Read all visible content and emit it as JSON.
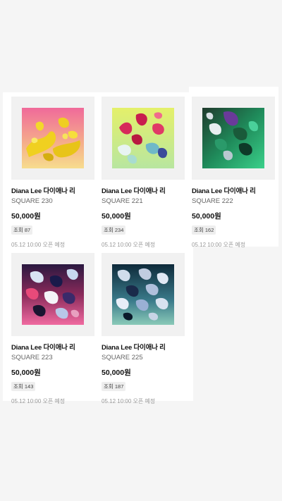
{
  "products": [
    {
      "artist": "Diana Lee 다이애나 리",
      "title": "SQUARE 230",
      "price": "50,000원",
      "views": "조회 87",
      "open": "05.12 10:00 오픈 예정",
      "art": "yellow-abstract-art"
    },
    {
      "artist": "Diana Lee 다이애나 리",
      "title": "SQUARE 221",
      "price": "50,000원",
      "views": "조회 234",
      "open": "05.12 10:00 오픈 예정",
      "art": "lime-petals-art"
    },
    {
      "artist": "Diana Lee 다이애나 리",
      "title": "SQUARE 222",
      "price": "50,000원",
      "views": "조회 162",
      "open": "05.12 10:00 오픈 예정",
      "art": "green-crystal-art"
    },
    {
      "artist": "Diana Lee 다이애나 리",
      "title": "SQUARE 223",
      "price": "50,000원",
      "views": "조회 143",
      "open": "05.12 10:00 오픈 예정",
      "art": "pink-navy-art"
    },
    {
      "artist": "Diana Lee 다이애나 리",
      "title": "SQUARE 225",
      "price": "50,000원",
      "views": "조회 187",
      "open": "05.12 10:00 오픈 예정",
      "art": "teal-silver-art"
    }
  ],
  "colors": {
    "background": "#f5f5f5",
    "card_bg": "#ffffff",
    "thumb_bg": "#f1f1f1",
    "badge_bg": "#eeeeee",
    "muted_text": "#999999"
  }
}
